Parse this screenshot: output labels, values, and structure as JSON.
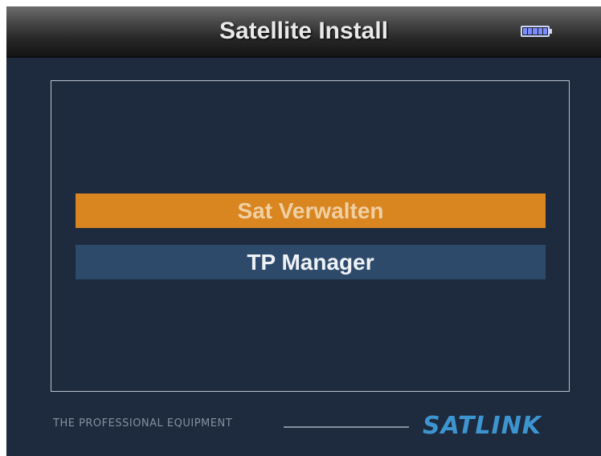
{
  "header": {
    "title": "Satellite Install",
    "battery_icon": "battery-full-icon",
    "battery_level": 1.0
  },
  "menu": {
    "items": [
      {
        "label": "Sat Verwalten",
        "selected": true
      },
      {
        "label": "TP Manager",
        "selected": false
      }
    ]
  },
  "footer": {
    "tagline": "THE PROFESSIONAL EQUIPMENT",
    "brand": "SATLINK"
  },
  "colors": {
    "background": "#1e2a3d",
    "selected_item": "#d98520",
    "normal_item": "#2e4a6a",
    "brand_blue": "#3d95d0"
  }
}
